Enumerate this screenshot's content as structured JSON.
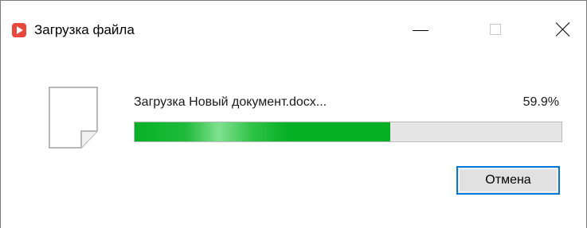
{
  "window": {
    "title": "Загрузка файла",
    "app_icon": "video-play-icon",
    "controls": {
      "minimize_icon": "minimize-icon",
      "maximize_icon": "maximize-icon",
      "close_icon": "close-icon"
    }
  },
  "download": {
    "file_icon": "document-file-icon",
    "status": "Загрузка Новый документ.docx...",
    "percent_label": "59.9%",
    "progress": 0.599
  },
  "buttons": {
    "cancel_label": "Отмена"
  },
  "colors": {
    "accent": "#0078d7",
    "progress_green": "#06b025",
    "app_icon_red": "#e8473c"
  }
}
